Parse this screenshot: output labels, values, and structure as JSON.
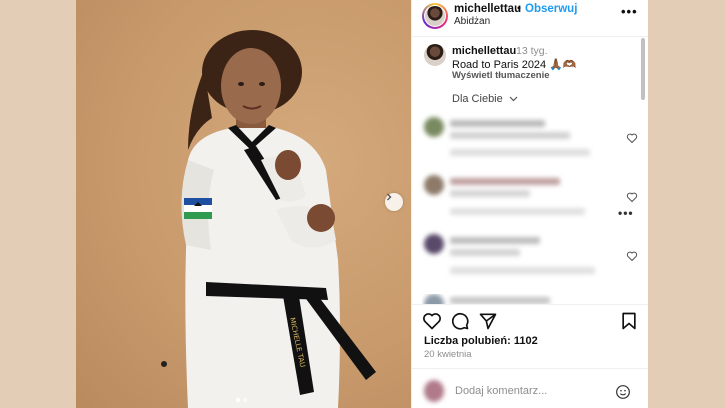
{
  "post": {
    "username": "michellettau",
    "separator": "•",
    "follow_label": "Obserwuj",
    "location": "Abidżan",
    "more_label": "•••",
    "carousel": {
      "slides": 2,
      "active": 1
    }
  },
  "caption": {
    "username": "michellettau",
    "time": "13 tyg.",
    "text": "Road to Paris 2024 🙏🏾🫶🏾",
    "translate_label": "Wyświetl tłumaczenie"
  },
  "comments": {
    "filter_label": "Dla Ciebie",
    "more_label": "•••"
  },
  "actions": {
    "likes": "Liczba polubień: 1102",
    "date": "20 kwietnia",
    "comment_placeholder": "Dodaj komentarz..."
  },
  "colors": {
    "accent": "#1d9bf0",
    "backdrop": "#e3cdb6",
    "photo_bg": "#c89a6c"
  }
}
